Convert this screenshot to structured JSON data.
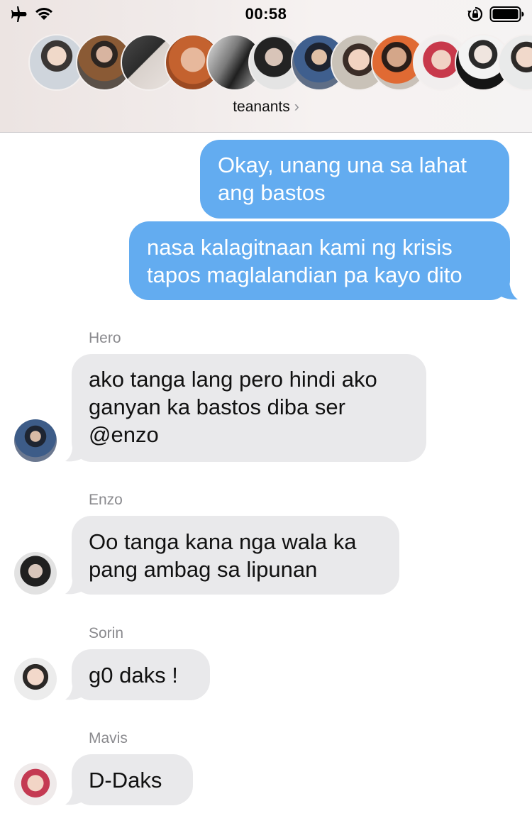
{
  "status_bar": {
    "time": "00:58",
    "icons": [
      "airplane-icon",
      "wifi-icon",
      "orientation-lock-icon",
      "battery-icon"
    ]
  },
  "group": {
    "name": "teanants",
    "chevron": "›",
    "member_count_shown": 13
  },
  "colors": {
    "outgoing_bubble": "#63acf0",
    "incoming_bubble": "#e9e9eb",
    "sender_label": "#8a8a8e"
  },
  "messages": [
    {
      "direction": "outgoing",
      "lines": [
        "Okay, unang una sa lahat",
        "ang bastos"
      ]
    },
    {
      "direction": "outgoing",
      "lines": [
        "nasa kalagitnaan kami ng krisis",
        "tapos maglalandian pa kayo dito"
      ]
    },
    {
      "direction": "incoming",
      "sender": "Hero",
      "lines": [
        "ako tanga lang pero hindi ako",
        "ganyan ka bastos diba ser",
        "@enzo"
      ]
    },
    {
      "direction": "incoming",
      "sender": "Enzo",
      "lines": [
        "Oo tanga kana nga wala ka",
        "pang ambag sa lipunan"
      ]
    },
    {
      "direction": "incoming",
      "sender": "Sorin",
      "lines": [
        "g0 daks !"
      ]
    },
    {
      "direction": "incoming",
      "sender": "Mavis",
      "lines": [
        "D-Daks"
      ]
    }
  ]
}
